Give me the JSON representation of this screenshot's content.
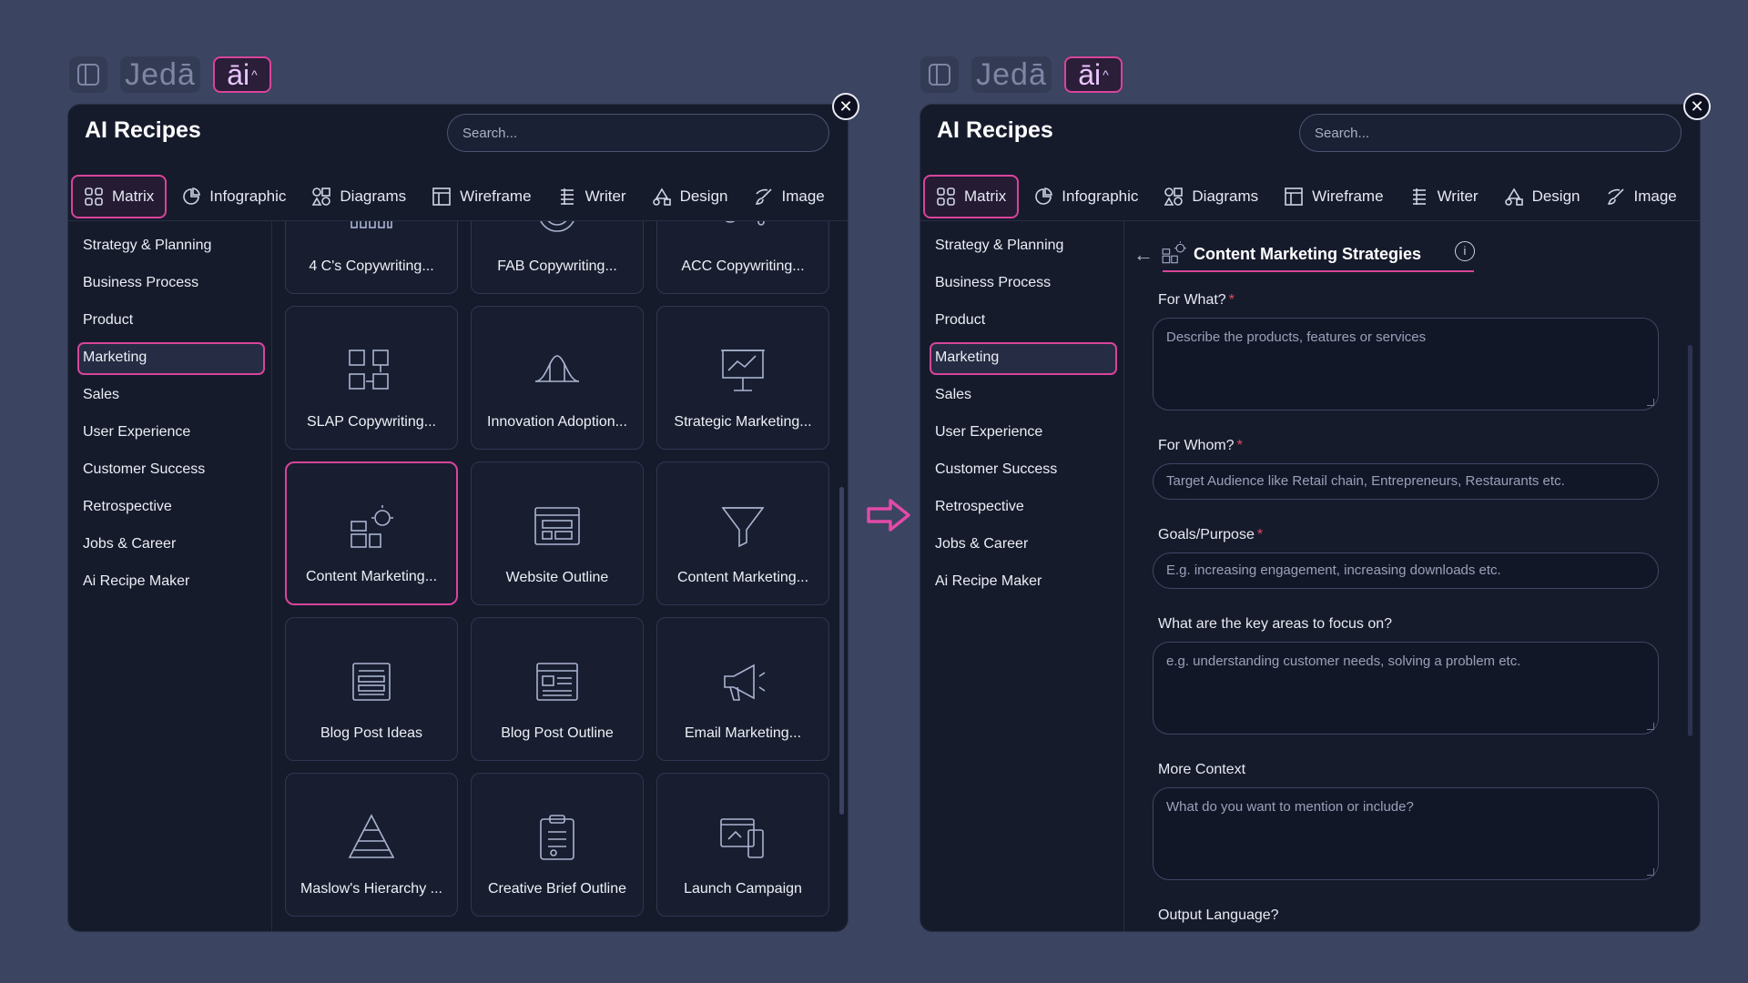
{
  "brand": {
    "logo": "Jedā",
    "ai_label": "āi",
    "caret": "^"
  },
  "title": "AI Recipes",
  "search_placeholder": "Search...",
  "tabs": [
    {
      "label": "Matrix",
      "icon": "grid-icon"
    },
    {
      "label": "Infographic",
      "icon": "pie-chart-icon"
    },
    {
      "label": "Diagrams",
      "icon": "shapes-icon"
    },
    {
      "label": "Wireframe",
      "icon": "wireframe-icon"
    },
    {
      "label": "Writer",
      "icon": "writer-icon"
    },
    {
      "label": "Design",
      "icon": "design-icon"
    },
    {
      "label": "Image",
      "icon": "brush-icon"
    }
  ],
  "nav": [
    "Strategy & Planning",
    "Business Process",
    "Product",
    "Marketing",
    "Sales",
    "User Experience",
    "Customer Success",
    "Retrospective",
    "Jobs & Career",
    "Ai Recipe Maker"
  ],
  "active_nav": "Marketing",
  "cards": [
    {
      "label": "4 C's Copywriting...",
      "icon": "bars-icon"
    },
    {
      "label": "FAB Copywriting...",
      "icon": "target-icon"
    },
    {
      "label": "ACC Copywriting...",
      "icon": "network-icon"
    },
    {
      "label": "SLAP Copywriting...",
      "icon": "flow-boxes-icon"
    },
    {
      "label": "Innovation Adoption...",
      "icon": "bell-curve-icon"
    },
    {
      "label": "Strategic Marketing...",
      "icon": "presentation-board-icon"
    },
    {
      "label": "Content Marketing...",
      "icon": "content-ideas-icon"
    },
    {
      "label": "Website Outline",
      "icon": "website-icon"
    },
    {
      "label": "Content Marketing...",
      "icon": "funnel-icon"
    },
    {
      "label": "Blog Post Ideas",
      "icon": "blog-list-icon"
    },
    {
      "label": "Blog Post Outline",
      "icon": "blog-outline-icon"
    },
    {
      "label": "Email Marketing...",
      "icon": "megaphone-icon"
    },
    {
      "label": "Maslow's Hierarchy ...",
      "icon": "pyramid-icon"
    },
    {
      "label": "Creative Brief Outline",
      "icon": "clipboard-icon"
    },
    {
      "label": "Launch Campaign",
      "icon": "launch-icon"
    }
  ],
  "form": {
    "back": "←",
    "title": "Content Marketing Strategies",
    "info": "i",
    "fields": [
      {
        "label": "For What?",
        "required": "*",
        "placeholder": "Describe the products, features or services",
        "type": "multi"
      },
      {
        "label": "For Whom?",
        "required": "*",
        "placeholder": "Target Audience like Retail chain, Entrepreneurs, Restaurants etc.",
        "type": "single"
      },
      {
        "label": "Goals/Purpose",
        "required": "*",
        "placeholder": "E.g. increasing engagement, increasing downloads etc.",
        "type": "single"
      },
      {
        "label": "What are the key areas to focus on?",
        "required": "",
        "placeholder": "e.g. understanding customer needs, solving a problem etc.",
        "type": "multi"
      },
      {
        "label": "More Context",
        "required": "",
        "placeholder": "What do you want to mention or include?",
        "type": "multi"
      },
      {
        "label": "Output Language?",
        "required": "",
        "placeholder": "",
        "type": "cut"
      }
    ]
  },
  "colors": {
    "accent": "#d8449a",
    "background": "#3b4460",
    "panel": "#161b2c"
  }
}
